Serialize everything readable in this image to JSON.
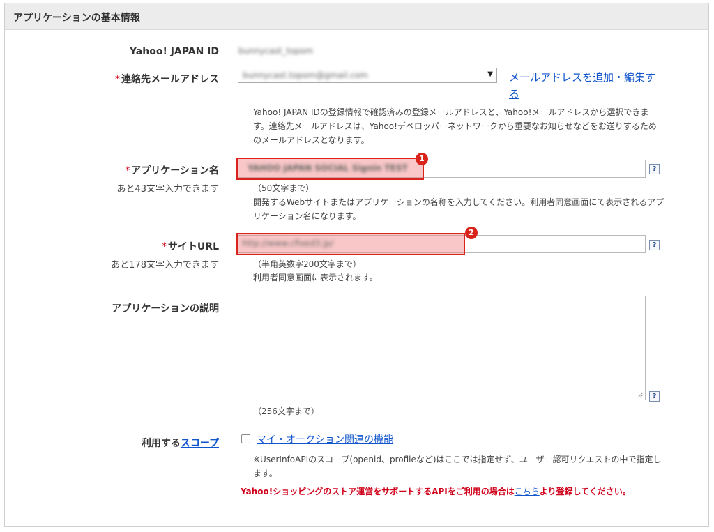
{
  "section": {
    "title": "アプリケーションの基本情報"
  },
  "yahoo_id": {
    "label": "Yahoo! JAPAN ID",
    "value": "bunnycast_topom"
  },
  "email": {
    "label": "連絡先メールアドレス",
    "selected": "bunnycast.topom@gmail.com",
    "add_link": "メールアドレスを追加・編集する",
    "note": "Yahoo! JAPAN IDの登録情報で確認済みの登録メールアドレスと、Yahoo!メールアドレスから選択できます。連絡先メールアドレスは、Yahoo!デベロッパーネットワークから重要なお知らせなどをお送りするためのメールアドレスとなります。"
  },
  "app_name": {
    "label": "アプリケーション名",
    "remaining": "あと43文字入力できます",
    "value": "YAHOO JAPAN SOCIAL Signin TEST",
    "limit": "（50文字まで）",
    "note": "開発するWebサイトまたはアプリケーションの名称を入力してください。利用者同意画面にて表示されるアプリケーション名になります。",
    "badge": "1"
  },
  "site_url": {
    "label": "サイトURL",
    "remaining": "あと178文字入力できます",
    "value": "http://www.cfixed3.jp/",
    "limit": "（半角英数字200文字まで）",
    "note": "利用者同意画面に表示されます。",
    "badge": "2"
  },
  "description": {
    "label": "アプリケーションの説明",
    "limit": "（256文字まで）"
  },
  "scope": {
    "label_prefix": "利用する",
    "label_link": "スコープ",
    "option": "マイ・オークション関連の機能",
    "note": "※UserInfoAPIのスコープ(openid、profileなど)はここでは指定せず、ユーザー認可リクエストの中で指定します。",
    "warning_before": "Yahoo!ショッピングのストア運営をサポートするAPIをご利用の場合は",
    "warning_link": "こちら",
    "warning_after": "より登録してください。"
  },
  "help_glyph": "?",
  "required_mark": "*",
  "dropdown_arrow": "▼",
  "colors": {
    "required": "#d0021b",
    "link": "#1155cc",
    "highlight": "#d9241b"
  }
}
